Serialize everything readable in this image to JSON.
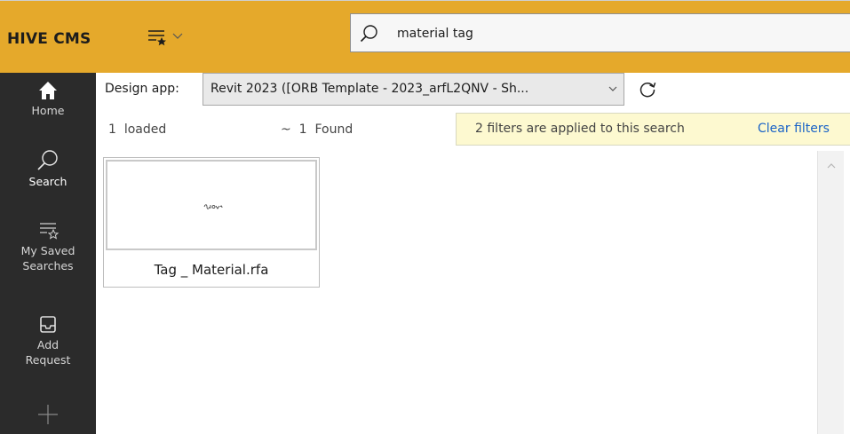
{
  "header": {
    "brand": "HIVE CMS",
    "saved_searches_icon": "saved-searches-icon",
    "search": {
      "value": "material tag",
      "icon": "search-icon"
    }
  },
  "sidebar": {
    "items": [
      {
        "label": "Home",
        "icon": "home-icon",
        "active": false
      },
      {
        "label": "Search",
        "icon": "search-icon",
        "active": true
      },
      {
        "label": "My Saved Searches",
        "icon": "saved-searches-icon",
        "active": false
      },
      {
        "label": "Add Request",
        "icon": "inbox-icon",
        "active": false
      },
      {
        "label": "",
        "icon": "plus-icon",
        "active": false
      }
    ]
  },
  "design_app": {
    "label": "Design app:",
    "selected": "Revit 2023 ([ORB Template - 2023_arfL2QNV - Sh...",
    "refresh_icon": "refresh-icon"
  },
  "results_info": {
    "loaded_count": "1",
    "loaded_label": "loaded",
    "found_prefix": "~",
    "found_count": "1",
    "found_label": "Found",
    "filter_message": "2 filters are applied to this search",
    "clear_label": "Clear filters"
  },
  "results": [
    {
      "name": "Tag _ Material.rfa",
      "thumbnail_icon": "family-thumbnail-icon"
    }
  ],
  "colors": {
    "accent": "#e5a92b",
    "sidebar": "#2b2b2b",
    "banner": "#fdf9d0",
    "link": "#1a63c7"
  }
}
